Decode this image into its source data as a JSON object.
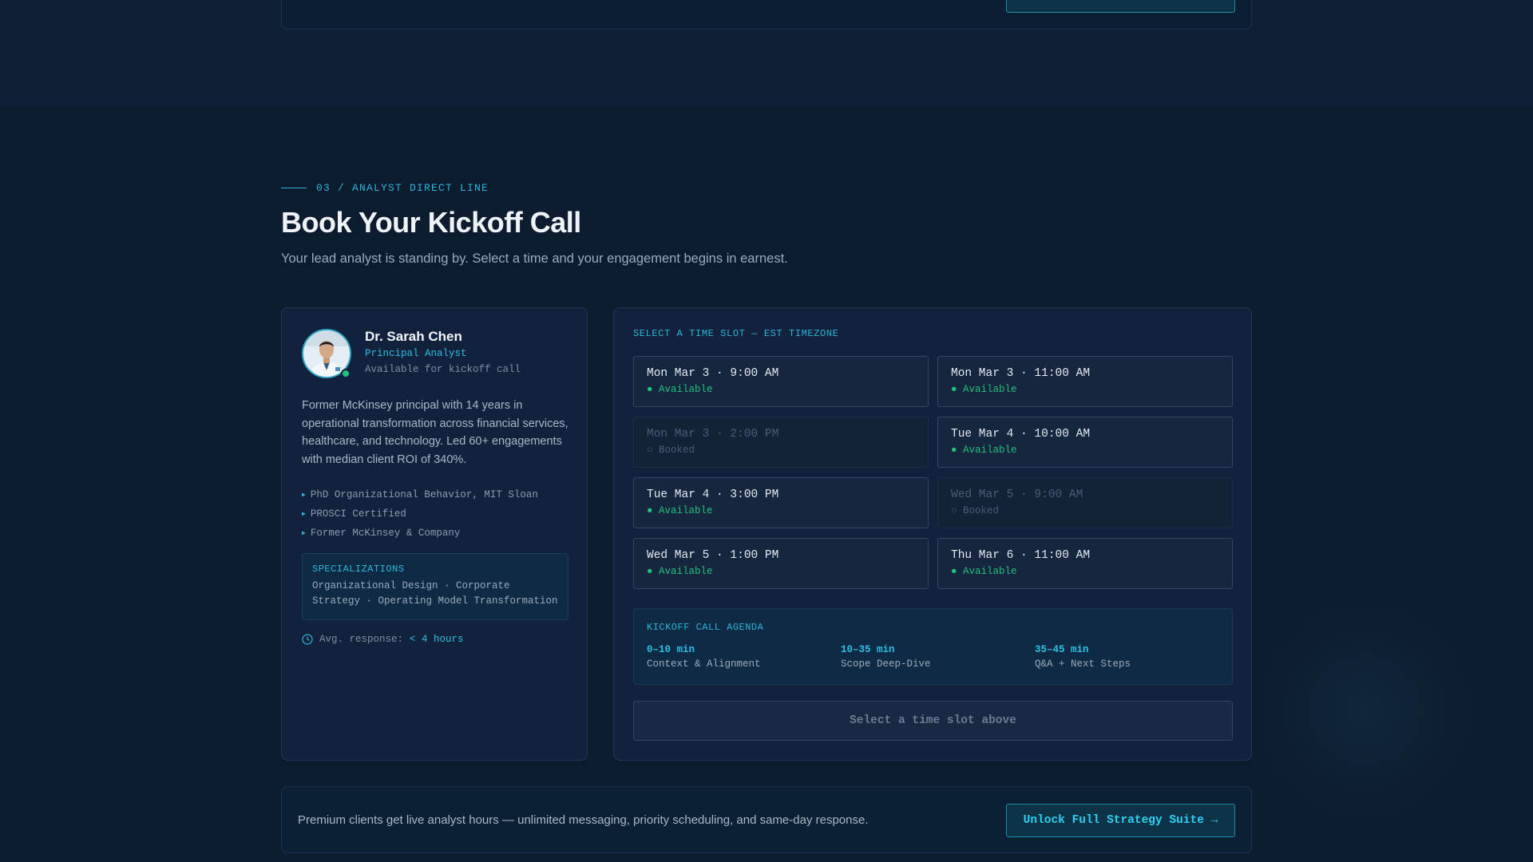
{
  "section": {
    "eyebrow": "03 / ANALYST DIRECT LINE",
    "title": "Book Your Kickoff Call",
    "subtitle": "Your lead analyst is standing by. Select a time and your engagement begins in earnest."
  },
  "analyst": {
    "name": "Dr. Sarah Chen",
    "role": "Principal Analyst",
    "availability": "Available for kickoff call",
    "bio": "Former McKinsey principal with 14 years in operational transformation across financial services, healthcare, and technology. Led 60+ engagements with median client ROI of 340%.",
    "credentials": [
      "PhD Organizational Behavior, MIT Sloan",
      "PROSCI Certified",
      "Former McKinsey & Company"
    ],
    "specializations_label": "SPECIALIZATIONS",
    "specializations": "Organizational Design · Corporate Strategy · Operating Model Transformation",
    "response_label": "Avg. response:",
    "response_value": "< 4 hours",
    "status_color": "#1fc27a"
  },
  "booking": {
    "label": "SELECT A TIME SLOT — EST TIMEZONE",
    "slots": [
      {
        "when": "Mon Mar 3 · 9:00 AM",
        "status": "● Available"
      },
      {
        "when": "Mon Mar 3 · 11:00 AM",
        "status": "● Available"
      },
      {
        "when": "Mon Mar 3 · 2:00 PM",
        "status": "○ Booked"
      },
      {
        "when": "Tue Mar 4 · 10:00 AM",
        "status": "● Available"
      },
      {
        "when": "Tue Mar 4 · 3:00 PM",
        "status": "● Available"
      },
      {
        "when": "Wed Mar 5 · 9:00 AM",
        "status": "○ Booked"
      },
      {
        "when": "Wed Mar 5 · 1:00 PM",
        "status": "● Available"
      },
      {
        "when": "Thu Mar 6 · 11:00 AM",
        "status": "● Available"
      }
    ],
    "agenda": {
      "label": "KICKOFF CALL AGENDA",
      "items": [
        {
          "time": "0–10 min",
          "desc": "Context & Alignment"
        },
        {
          "time": "10–35 min",
          "desc": "Scope Deep-Dive"
        },
        {
          "time": "35–45 min",
          "desc": "Q&A + Next Steps"
        }
      ]
    },
    "confirm_label": "Select a time slot above"
  },
  "premium": {
    "text": "Premium clients get live analyst hours — unlimited messaging, priority scheduling, and same-day response.",
    "button": "Unlock Full Strategy Suite →"
  },
  "colors": {
    "accent": "#2bb6d9",
    "available": "#1fc27a",
    "background": "#0d1b2e"
  }
}
